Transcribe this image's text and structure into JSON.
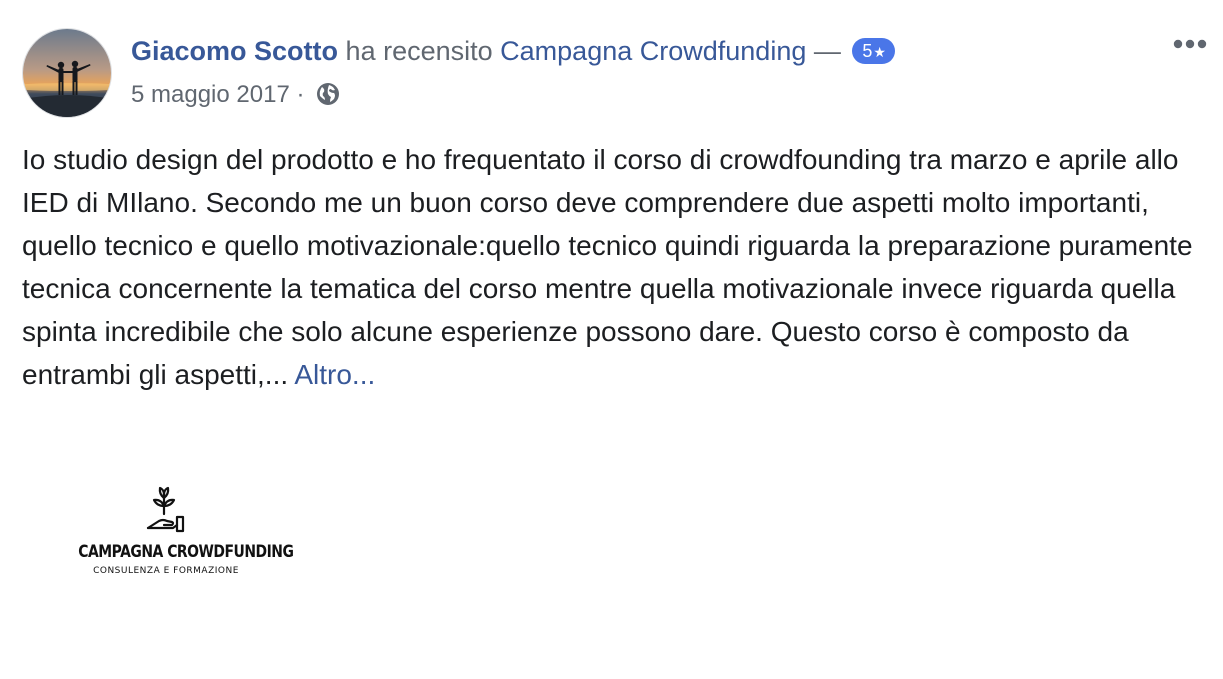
{
  "review": {
    "author_name": "Giacomo Scotto",
    "action_text": "ha recensito",
    "page_name": "Campagna Crowdfunding",
    "dash": "—",
    "rating": "5",
    "rating_star": "★",
    "date": "5 maggio 2017",
    "separator": "·",
    "privacy_icon": "globe-icon",
    "more_icon": "more-options-icon",
    "body": "Io studio design del prodotto e ho frequentato il corso di crowdfounding tra marzo e aprile allo IED di MIlano. Secondo me un buon corso deve comprendere due aspetti molto importanti, quello tecnico e quello motivazionale:quello tecnico quindi riguarda la preparazione puramente tecnica concernente la tematica del corso mentre quella motivazionale invece riguarda quella spinta incredibile che solo alcune esperienze possono dare. Questo corso è composto da entrambi gli aspetti,...",
    "more_label": "Altro..."
  },
  "attachment": {
    "logo_title": "CAMPAGNA CROWDFUNDING",
    "logo_subtitle": "CONSULENZA E FORMAZIONE",
    "logo_icon": "hand-plant-icon"
  },
  "colors": {
    "link": "#385898",
    "meta_text": "#606770",
    "body_text": "#1c1e21",
    "rating_badge": "#4a76e8"
  }
}
